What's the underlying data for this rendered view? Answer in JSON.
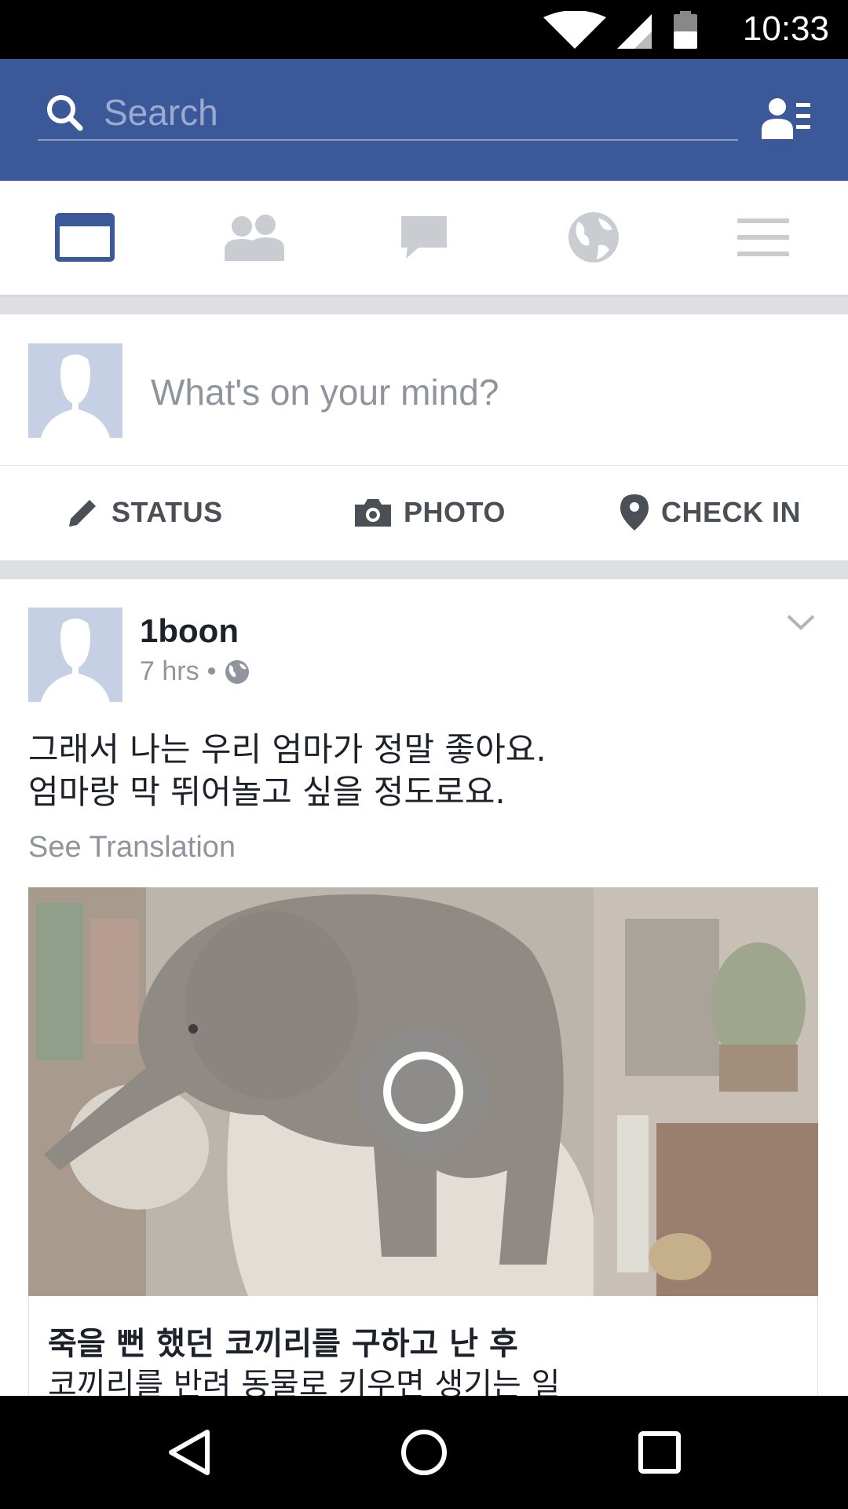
{
  "status_bar": {
    "time": "10:33"
  },
  "search": {
    "placeholder": "Search"
  },
  "nav_tabs": [
    {
      "name": "news-feed",
      "icon": "news-feed-icon",
      "active": true
    },
    {
      "name": "friends",
      "icon": "friends-icon",
      "active": false
    },
    {
      "name": "messages",
      "icon": "chat-icon",
      "active": false
    },
    {
      "name": "notifications",
      "icon": "globe-icon",
      "active": false
    },
    {
      "name": "more",
      "icon": "menu-icon",
      "active": false
    }
  ],
  "composer": {
    "prompt": "What's on your mind?",
    "actions": [
      {
        "label": "STATUS",
        "icon": "pencil-icon"
      },
      {
        "label": "PHOTO",
        "icon": "camera-icon"
      },
      {
        "label": "CHECK IN",
        "icon": "location-pin-icon"
      }
    ]
  },
  "post": {
    "author": "1boon",
    "time": "7 hrs",
    "separator": "•",
    "text_line1": "그래서 나는 우리 엄마가 정말 좋아요.",
    "text_line2": "엄마랑 막 뛰어놀고 싶을 정도로요.",
    "see_translation": "See Translation",
    "link_title": "죽을 뻔 했던 코끼리를 구하고 난 후",
    "link_subtitle": "코끼리를 반려 동물로 키우면 생기는 일"
  },
  "colors": {
    "brand": "#3b5998",
    "inactive_icon": "#c9ccd1",
    "gray_text": "#90949c"
  }
}
